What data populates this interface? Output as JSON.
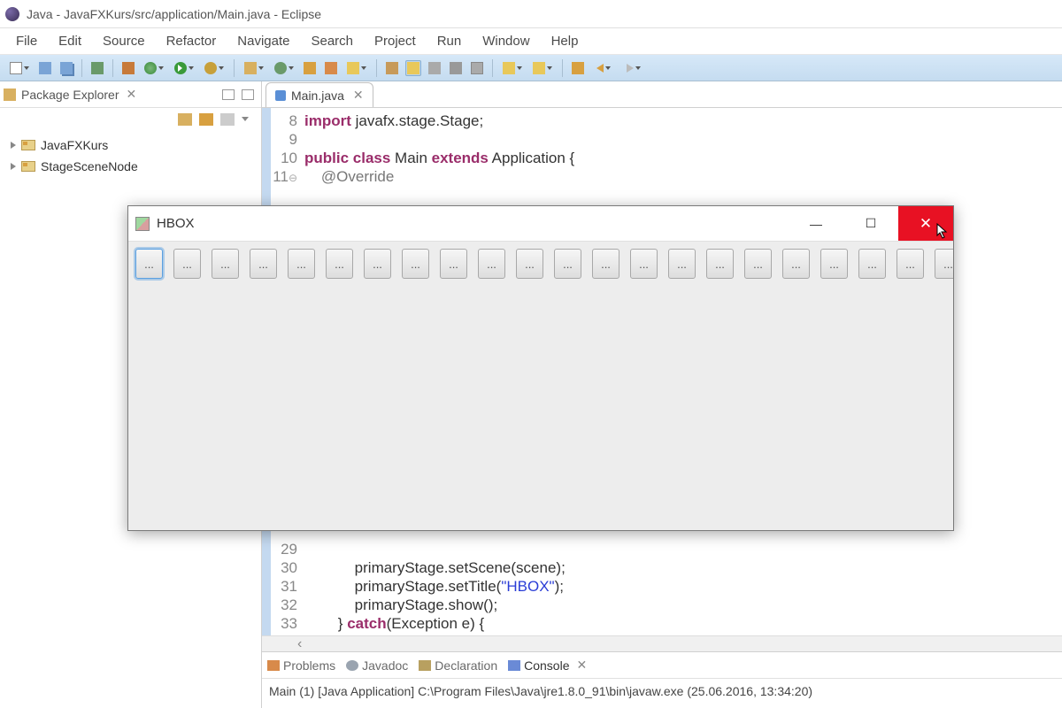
{
  "window": {
    "title": "Java - JavaFXKurs/src/application/Main.java - Eclipse"
  },
  "menu": [
    "File",
    "Edit",
    "Source",
    "Refactor",
    "Navigate",
    "Search",
    "Project",
    "Run",
    "Window",
    "Help"
  ],
  "packageExplorer": {
    "title": "Package Explorer",
    "projects": [
      "JavaFXKurs",
      "StageSceneNode"
    ]
  },
  "editor": {
    "tab": "Main.java",
    "lines": {
      "l8": {
        "n": "8",
        "a": "import",
        "b": " javafx.stage.Stage;"
      },
      "l9": {
        "n": "9",
        "a": "",
        "b": ""
      },
      "l10": {
        "n": "10",
        "a": "public class",
        "b": " Main ",
        "c": "extends",
        "d": " Application {"
      },
      "l11": {
        "n": "11",
        "ann": "    @Override",
        "marker": "⊖"
      },
      "l29": {
        "n": "29"
      },
      "l30": {
        "n": "30",
        "b": "            primaryStage.setScene(scene);"
      },
      "l31": {
        "n": "31",
        "b": "            primaryStage.setTitle(",
        "s": "\"HBOX\"",
        "c": ");"
      },
      "l32": {
        "n": "32",
        "b": "            primaryStage.show();"
      },
      "l33": {
        "n": "33",
        "b": "        } ",
        "a": "catch",
        "c": "(Exception e) {"
      }
    }
  },
  "bottom": {
    "tabs": [
      "Problems",
      "Javadoc",
      "Declaration",
      "Console"
    ],
    "console": "Main (1) [Java Application] C:\\Program Files\\Java\\jre1.8.0_91\\bin\\javaw.exe (25.06.2016, 13:34:20)"
  },
  "popup": {
    "title": "HBOX",
    "buttonLabel": "...",
    "buttonCount": 22
  }
}
